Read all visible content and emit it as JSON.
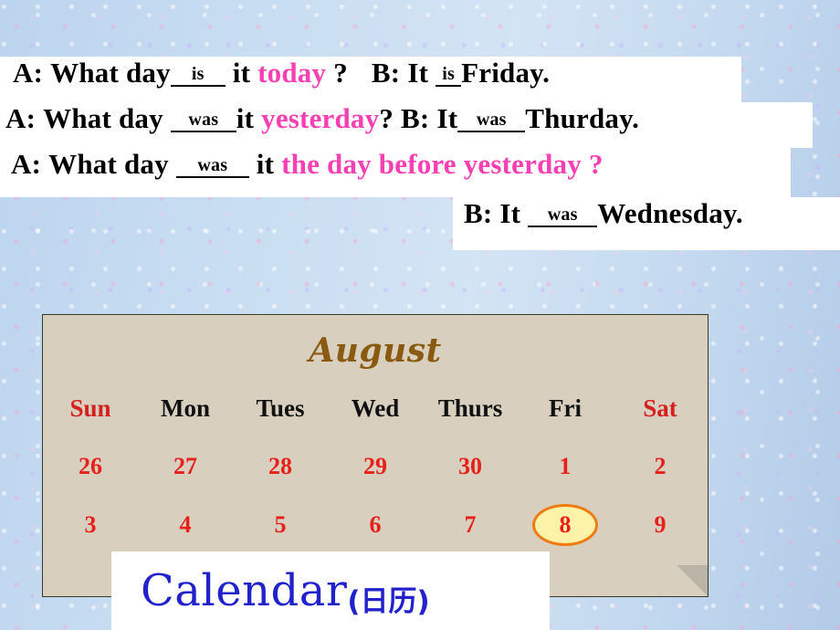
{
  "dialogue": {
    "line1": {
      "a_label": "A:",
      "a_q1": "What day",
      "blank1": "is",
      "a_q2": "it",
      "a_kw": "today",
      "a_mark": "?",
      "b_label": "B:",
      "b_it": "It",
      "blank2": "is",
      "b_day": "Friday."
    },
    "line2": {
      "a_label": "A:",
      "a_q1": "What day",
      "blank1": "was",
      "a_q2": "it",
      "a_kw": "yesterday",
      "a_mark": "?",
      "b_label": "B:",
      "b_it": "It",
      "blank2": "was",
      "b_day": "Thurday."
    },
    "line3": {
      "a_label": "A:",
      "a_q1": "What day",
      "blank1": "was",
      "a_q2": "it",
      "a_kw": "the day before yesterday",
      "a_mark": "?"
    },
    "line4": {
      "b_label": "B:",
      "b_it": "It",
      "blank": "was",
      "b_day": "Wednesday."
    }
  },
  "calendar": {
    "month": "August",
    "weekdays": [
      "Sun",
      "Mon",
      "Tues",
      "Wed",
      "Thurs",
      "Fri",
      "Sat"
    ],
    "weeks": [
      [
        "26",
        "27",
        "28",
        "29",
        "30",
        "1",
        "2"
      ],
      [
        "3",
        "4",
        "5",
        "6",
        "7",
        "8",
        "9"
      ]
    ],
    "highlighted_day": "8",
    "caption_en": "Calendar",
    "caption_zh": "(日历)",
    "colors": {
      "weekend_header": "#d42020",
      "weekday_header": "#111111",
      "dates": "#e8201c",
      "highlight_fill": "#fdf3a8",
      "highlight_border": "#ef7b10",
      "month_title": "#8a5a10",
      "paper": "#d8cfbe"
    }
  }
}
